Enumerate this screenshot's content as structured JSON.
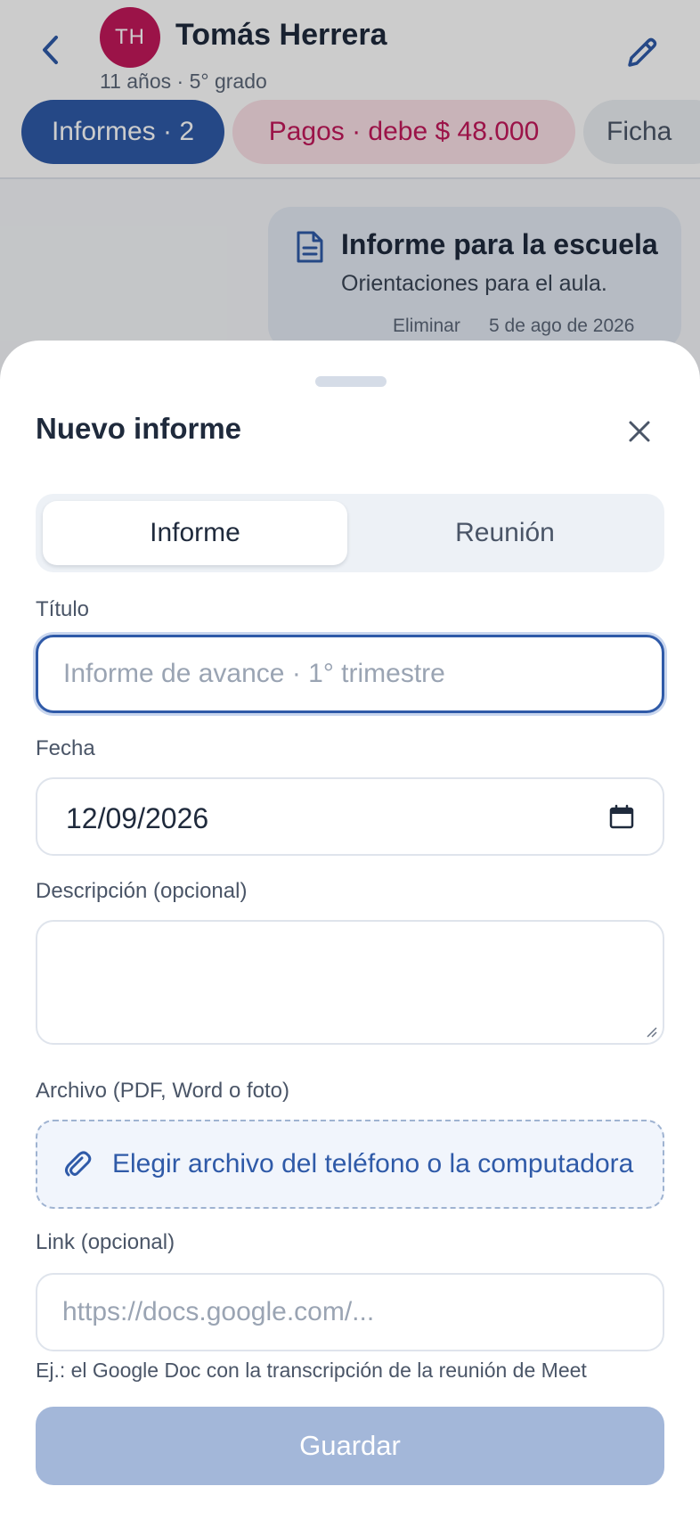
{
  "student": {
    "initials": "TH",
    "name": "Tomás Herrera",
    "meta": "11 años · 5° grado"
  },
  "tabs": [
    {
      "label": "Informes · 2"
    },
    {
      "label": "Pagos · debe $ 48.000"
    },
    {
      "label": "Ficha"
    }
  ],
  "report_card": {
    "title": "Informe para la escuela",
    "description": "Orientaciones para el aula.",
    "delete_label": "Eliminar",
    "date": "5 de ago de 2026"
  },
  "sheet": {
    "title": "Nuevo informe",
    "segment": {
      "options": [
        "Informe",
        "Reunión"
      ],
      "selected": "Informe"
    },
    "title_field": {
      "label": "Título",
      "placeholder": "Informe de avance · 1° trimestre",
      "value": ""
    },
    "date_field": {
      "label": "Fecha",
      "value": "12/09/2026"
    },
    "description_field": {
      "label": "Descripción (opcional)",
      "value": ""
    },
    "file_field": {
      "label": "Archivo (PDF, Word o foto)",
      "button_text": "Elegir archivo del teléfono o la computadora"
    },
    "link_field": {
      "label": "Link (opcional)",
      "placeholder": "https://docs.google.com/...",
      "hint": "Ej.: el Google Doc con la transcripción de la reunión de Meet"
    },
    "save_label": "Guardar"
  },
  "colors": {
    "accent": "#2f5aa8",
    "avatar": "#c2185b",
    "debt": "#c2185b",
    "save_disabled": "#a3b7d9"
  },
  "icons": [
    "back-arrow-icon",
    "pencil-icon",
    "document-icon",
    "close-icon",
    "calendar-icon",
    "paperclip-icon"
  ]
}
